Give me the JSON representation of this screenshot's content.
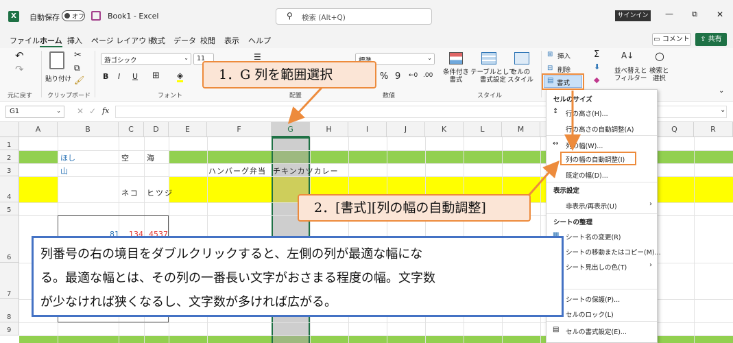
{
  "title_bar": {
    "autosave_label": "自動保存",
    "autosave_state": "オフ",
    "file_title": "Book1  -  Excel",
    "search_placeholder": "検索 (Alt+Q)",
    "signin_label": "サインイン",
    "minimize_glyph": "—",
    "restore_glyph": "⧉",
    "close_glyph": "✕"
  },
  "menu": {
    "items": [
      "ファイル",
      "ホーム",
      "挿入",
      "ページ レイアウト",
      "数式",
      "データ",
      "校閲",
      "表示",
      "ヘルプ"
    ],
    "comment_label": "コメント",
    "share_label": "共有"
  },
  "ribbon": {
    "undo_group": "元に戻す",
    "clipboard": {
      "paste_label": "貼り付け",
      "group": "クリップボード"
    },
    "font": {
      "name": "游ゴシック",
      "size": "11",
      "bold": "B",
      "italic": "I",
      "underline": "U",
      "group": "フォント"
    },
    "alignment": {
      "group": "配置"
    },
    "number": {
      "format": "標準",
      "percent": "%",
      "comma": "9",
      "group": "数値"
    },
    "styles": {
      "conditional": "条件付き\n書式",
      "table": "テーブルとして\n書式設定",
      "cell": "セルの\nスタイル",
      "group": "スタイル"
    },
    "cells": {
      "insert": "挿入",
      "delete": "削除",
      "format": "書式"
    },
    "editing": {
      "sort": "並べ替えと\nフィルター",
      "find": "検索と\n選択"
    }
  },
  "formula_bar": {
    "name_box": "G1",
    "fx": "fx",
    "formula": ""
  },
  "grid": {
    "columns": [
      "A",
      "B",
      "C",
      "D",
      "E",
      "F",
      "G",
      "H",
      "I",
      "J",
      "K",
      "L",
      "M",
      "N",
      "O",
      "P",
      "Q",
      "R"
    ],
    "rows": [
      "1",
      "2",
      "3",
      "4",
      "5",
      "6",
      "7",
      "8",
      "9"
    ],
    "cells": {
      "B2": "ほし",
      "C2": "空",
      "D2": "海",
      "B3": "山",
      "F3": "ハンバーグ弁当",
      "G3": "チキンカツカレー",
      "C4": "ネコ",
      "D4": "ヒツジ",
      "B6": "81",
      "C6": "134",
      "D6": "4537"
    }
  },
  "format_menu": {
    "cell_size_header": "セルのサイズ",
    "items": [
      {
        "label": "行の高さ(H)..."
      },
      {
        "label": "行の高さの自動調整(A)"
      },
      {
        "label": "列の幅(W)..."
      },
      {
        "label": "列の幅の自動調整(I)"
      },
      {
        "label": "既定の幅(D)..."
      }
    ],
    "visibility_header": "表示設定",
    "hide_unhide": "非表示/再表示(U)",
    "organize_header": "シートの整理",
    "organize_items": [
      {
        "label": "シート名の変更(R)"
      },
      {
        "label": "シートの移動またはコピー(M)..."
      },
      {
        "label": "シート見出しの色(T)"
      }
    ],
    "protect_items": [
      {
        "label": "シートの保護(P)..."
      },
      {
        "label": "セルのロック(L)"
      },
      {
        "label": "セルの書式設定(E)..."
      }
    ]
  },
  "callouts": {
    "step1": "1．G 列を範囲選択",
    "step2": "2．[書式][列の幅の自動調整]",
    "explanation_lines": [
      "列番号の右の境目をダブルクリックすると、左側の列が最適な幅にな",
      "る。最適な幅とは、その列の一番長い文字がおさまる程度の幅。文字数",
      "が少なければ狭くなるし、文字数が多ければ広がる。"
    ]
  },
  "colors": {
    "excel_green": "#1e7145",
    "row_green": "#92d050",
    "row_yellow": "#ffff00",
    "selection_gray": "#a6a6a6",
    "callout_orange": "#ed8b3c",
    "callout_fill": "#fbe5d6",
    "info_border": "#4472c4"
  }
}
